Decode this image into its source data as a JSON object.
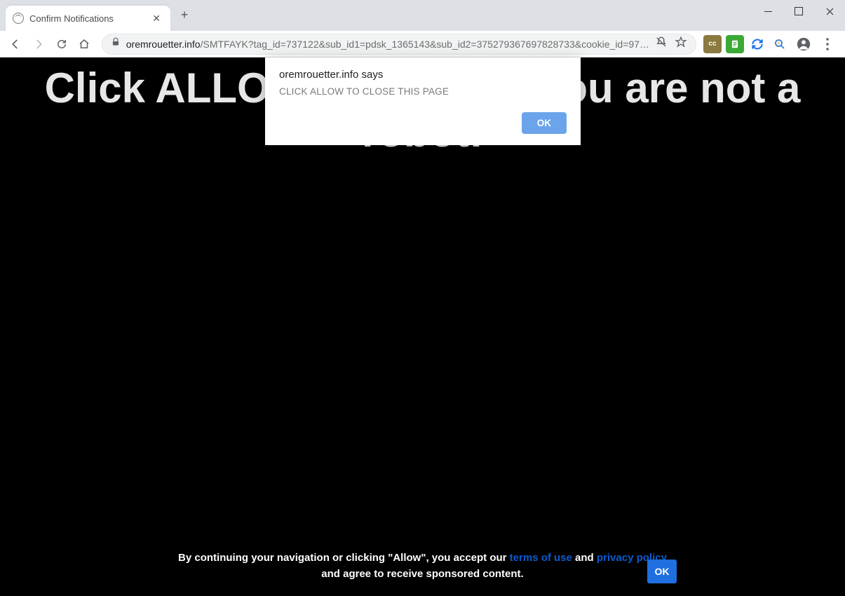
{
  "window": {
    "tab_title": "Confirm Notifications",
    "address": {
      "domain": "oremrouetter.info",
      "path": "/SMTFAYK?tag_id=737122&sub_id1=pdsk_1365143&sub_id2=375279367697828733&cookie_id=97…"
    },
    "extensions": {
      "cc_label": "cc"
    }
  },
  "page": {
    "headline_full": "Click ALLOW to confirm you are not a robot!"
  },
  "alert": {
    "origin": "oremrouetter.info says",
    "message": "CLICK ALLOW TO CLOSE THIS PAGE",
    "ok": "OK"
  },
  "consent": {
    "prefix": "By continuing your navigation or clicking \"Allow\", you accept our ",
    "terms": "terms of use",
    "and": " and ",
    "privacy": "privacy policy",
    "suffix": " and agree to receive sponsored content.",
    "ok": "OK"
  }
}
